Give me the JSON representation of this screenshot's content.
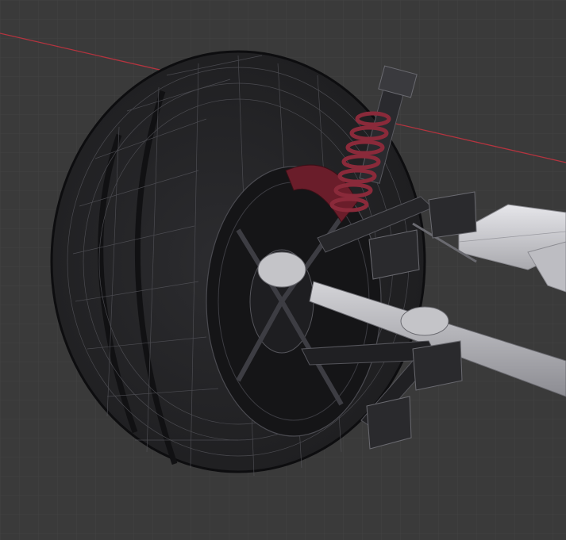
{
  "viewport": {
    "kind": "3d-modeling-viewport",
    "shading_mode": "wireframe-over-solid",
    "background_color": "#3a3a3a",
    "grid_color": "#424242",
    "axis_x_color": "#b4343f"
  },
  "model": {
    "parts": [
      "tire",
      "wheel-rim",
      "brake-disc",
      "brake-caliper",
      "coil-spring",
      "shock-absorber",
      "upper-control-arm",
      "lower-control-arm",
      "drive-shaft",
      "cv-boot",
      "subframe-beam",
      "mount-brackets"
    ],
    "colors": {
      "tire": "#262628",
      "rim": "#161618",
      "spring": "#8a2a3a",
      "beam": "#cfcfd3",
      "shaft": "#bdbdc2",
      "wire": "#6b6b70"
    }
  }
}
